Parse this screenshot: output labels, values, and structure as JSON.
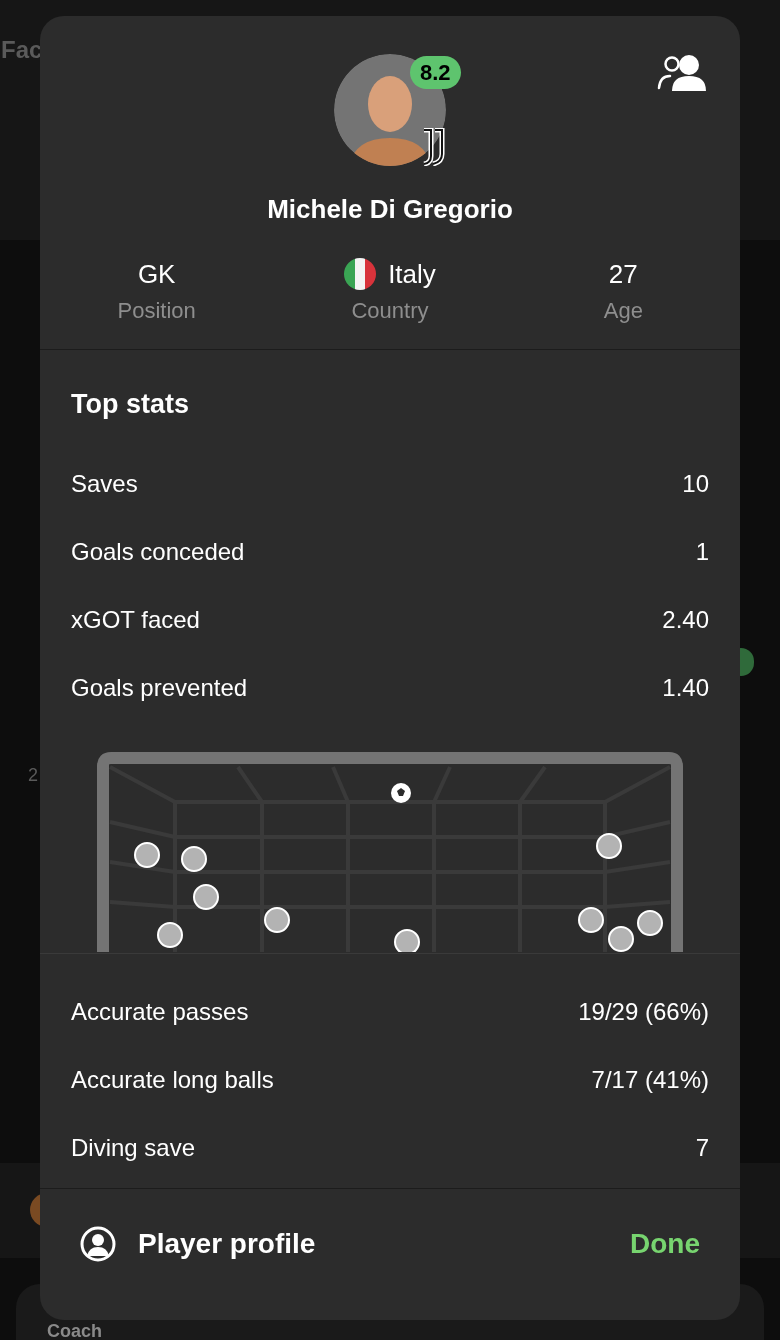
{
  "background": {
    "heading": "Fac",
    "axis_label": "2",
    "card_title": "Coach"
  },
  "player": {
    "rating": "8.2",
    "name": "Michele Di Gregorio"
  },
  "info": [
    {
      "value": "GK",
      "label": "Position",
      "kind": "text"
    },
    {
      "value": "Italy",
      "label": "Country",
      "kind": "flag"
    },
    {
      "value": "27",
      "label": "Age",
      "kind": "text"
    }
  ],
  "top_stats": {
    "title": "Top stats",
    "rows": [
      {
        "label": "Saves",
        "value": "10"
      },
      {
        "label": "Goals conceded",
        "value": "1"
      },
      {
        "label": "xGOT faced",
        "value": "2.40"
      },
      {
        "label": "Goals prevented",
        "value": "1.40"
      }
    ]
  },
  "more_stats": [
    {
      "label": "Accurate passes",
      "value": "19/29 (66%)"
    },
    {
      "label": "Accurate long balls",
      "value": "7/17 (41%)"
    },
    {
      "label": "Diving save",
      "value": "7"
    }
  ],
  "footer": {
    "profile_link": "Player profile",
    "done": "Done"
  }
}
